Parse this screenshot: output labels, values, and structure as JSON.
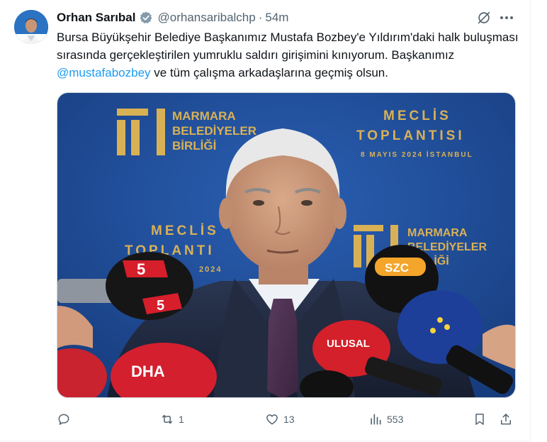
{
  "tweet": {
    "author_name": "Orhan Sarıbal",
    "handle": "@orhansaribalchp",
    "separator": "·",
    "time": "54m",
    "text_part1": "Bursa Büyükşehir Belediye Başkanımız Mustafa Bozbey'e Yıldırım'daki halk buluşması sırasında gerçekleştirilen yumruklu saldırı girişimini kınıyorum. Başkanımız ",
    "mention": "@mustafabozbey",
    "text_part2": " ve tüm çalışma arkadaşlarına geçmiş olsun."
  },
  "media": {
    "backdrop_left_logo_line1": "MARMARA",
    "backdrop_left_logo_line2": "BELEDİYELER",
    "backdrop_left_logo_line3": "BİRLİĞİ",
    "backdrop_right_line1": "MECLİS",
    "backdrop_right_line2": "TOPLANTISI",
    "backdrop_right_date": "8 MAYIS 2024  İSTANBUL",
    "backdrop_mid_line1": "MECLİS",
    "backdrop_mid_line2": "TOPLANTI",
    "backdrop_mid_date": "2024",
    "backdrop_right_logo_line1": "MARMARA",
    "backdrop_right_logo_line2": "BELEDİYELER",
    "backdrop_right_logo_line3": "BİRLİĞİ",
    "mic_left_top": "5",
    "mic_left_bottom": "5",
    "mic_szc": "SZC",
    "mic_ulusal": "ULUSAL",
    "mic_dha": "DHA"
  },
  "actions": {
    "reply_count": "",
    "retweet_count": "1",
    "like_count": "13",
    "views_count": "553"
  },
  "colors": {
    "accent": "#1d9bf0",
    "muted": "#536471",
    "backdrop_blue": "#1f4e9a",
    "logo_gold": "#d9b155"
  },
  "icons": [
    "verified-badge-icon",
    "grok-icon",
    "more-icon",
    "reply-icon",
    "retweet-icon",
    "like-icon",
    "views-icon",
    "bookmark-icon",
    "share-icon"
  ]
}
